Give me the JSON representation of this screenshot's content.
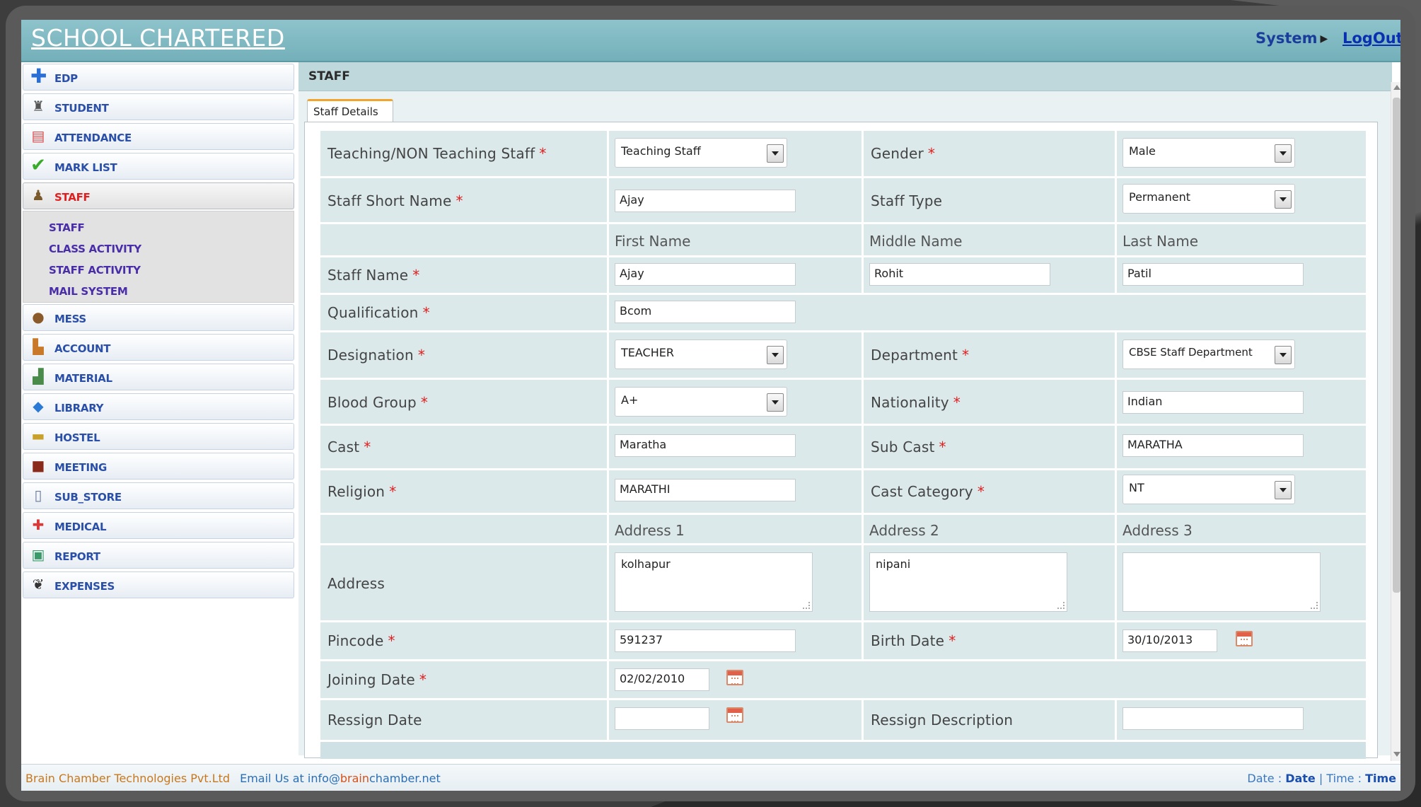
{
  "header": {
    "app_title": "SCHOOL CHARTERED",
    "system_menu": "System",
    "logout": "LogOut"
  },
  "sidebar": {
    "items": [
      {
        "label": "EDP",
        "icon": "plus-icon"
      },
      {
        "label": "STUDENT",
        "icon": "student-icon"
      },
      {
        "label": "ATTENDANCE",
        "icon": "calendar-icon"
      },
      {
        "label": "MARK LIST",
        "icon": "checkmark-icon"
      },
      {
        "label": "STAFF",
        "icon": "staff-icon"
      },
      {
        "label": "MESS",
        "icon": "mess-icon"
      },
      {
        "label": "ACCOUNT",
        "icon": "account-icon"
      },
      {
        "label": "MATERIAL",
        "icon": "material-icon"
      },
      {
        "label": "LIBRARY",
        "icon": "library-icon"
      },
      {
        "label": "HOSTEL",
        "icon": "hostel-icon"
      },
      {
        "label": "MEETING",
        "icon": "meeting-icon"
      },
      {
        "label": "SUB_STORE",
        "icon": "store-icon"
      },
      {
        "label": "MEDICAL",
        "icon": "medical-icon"
      },
      {
        "label": "REPORT",
        "icon": "report-icon"
      },
      {
        "label": "EXPENSES",
        "icon": "expenses-icon"
      }
    ],
    "staff_submenu": [
      "STAFF",
      "CLASS ACTIVITY",
      "STAFF ACTIVITY",
      "MAIL SYSTEM"
    ]
  },
  "content": {
    "title": "STAFF",
    "tab": "Staff Details"
  },
  "form": {
    "teaching_label": "Teaching/NON Teaching Staff",
    "teaching_value": "Teaching Staff",
    "gender_label": "Gender",
    "gender_value": "Male",
    "short_name_label": "Staff Short Name",
    "short_name_value": "Ajay",
    "staff_type_label": "Staff Type",
    "staff_type_value": "Permanent",
    "first_name_hdr": "First Name",
    "middle_name_hdr": "Middle Name",
    "last_name_hdr": "Last Name",
    "staff_name_label": "Staff Name",
    "first_name_value": "Ajay",
    "middle_name_value": "Rohit",
    "last_name_value": "Patil",
    "qualification_label": "Qualification",
    "qualification_value": "Bcom",
    "designation_label": "Designation",
    "designation_value": "TEACHER",
    "department_label": "Department",
    "department_value": "CBSE Staff Department",
    "blood_group_label": "Blood Group",
    "blood_group_value": "A+",
    "nationality_label": "Nationality",
    "nationality_value": "Indian",
    "cast_label": "Cast",
    "cast_value": "Maratha",
    "sub_cast_label": "Sub Cast",
    "sub_cast_value": "MARATHA",
    "religion_label": "Religion",
    "religion_value": "MARATHI",
    "cast_category_label": "Cast Category",
    "cast_category_value": "NT",
    "address1_hdr": "Address 1",
    "address2_hdr": "Address 2",
    "address3_hdr": "Address 3",
    "address_label": "Address",
    "address1_value": "kolhapur",
    "address2_value": "nipani",
    "address3_value": "",
    "pincode_label": "Pincode",
    "pincode_value": "591237",
    "birth_date_label": "Birth Date",
    "birth_date_value": "30/10/2013",
    "joining_date_label": "Joining Date",
    "joining_date_value": "02/02/2010",
    "ressign_date_label": "Ressign Date",
    "ressign_date_value": "",
    "ressign_desc_label": "Ressign Description",
    "ressign_desc_value": "",
    "required_mark": "*"
  },
  "footer": {
    "company": "Brain Chamber Technologies Pvt.Ltd",
    "email_prefix": "Email Us at info@",
    "email_brand": "brain",
    "email_suffix": "chamber.net",
    "date_label": "Date :",
    "date_value": "Date",
    "separator": "|",
    "time_label": "Time :",
    "time_value": "Time"
  },
  "colors": {
    "header_bg": "#80b9c2",
    "active_nav": "#e02020",
    "nav_text": "#2a4fa8",
    "required": "#e02020"
  }
}
